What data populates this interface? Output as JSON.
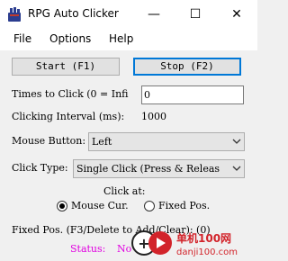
{
  "window": {
    "title": "RPG Auto Clicker",
    "minimize_glyph": "—",
    "maximize_glyph": "☐",
    "close_glyph": "✕"
  },
  "menu": {
    "items": [
      {
        "label": "File"
      },
      {
        "label": "Options"
      },
      {
        "label": "Help"
      }
    ]
  },
  "controls": {
    "start_label": "Start (F1)",
    "stop_label": "Stop (F2)",
    "times_label": "Times to Click (0 = Infi",
    "times_value": "0",
    "interval_label": "Clicking Interval (ms):",
    "interval_value": "1000",
    "mouse_button_label": "Mouse Button:",
    "mouse_button_value": "Left",
    "click_type_label": "Click Type:",
    "click_type_value": "Single Click (Press & Releas",
    "click_at_label": "Click at:",
    "click_at_options": [
      {
        "label": "Mouse Cur.",
        "checked": true
      },
      {
        "label": "Fixed Pos.",
        "checked": false
      }
    ],
    "fixed_pos_label": "Fixed Pos. (F3/Delete to Add/Clear): (0)",
    "status_label": "Status:",
    "status_value": "No"
  },
  "watermark": {
    "text1": "单机100网",
    "text2": "danji100.com"
  },
  "colors": {
    "focus": "#0078d7",
    "status": "#e000e0",
    "watermark": "#d2232a"
  }
}
